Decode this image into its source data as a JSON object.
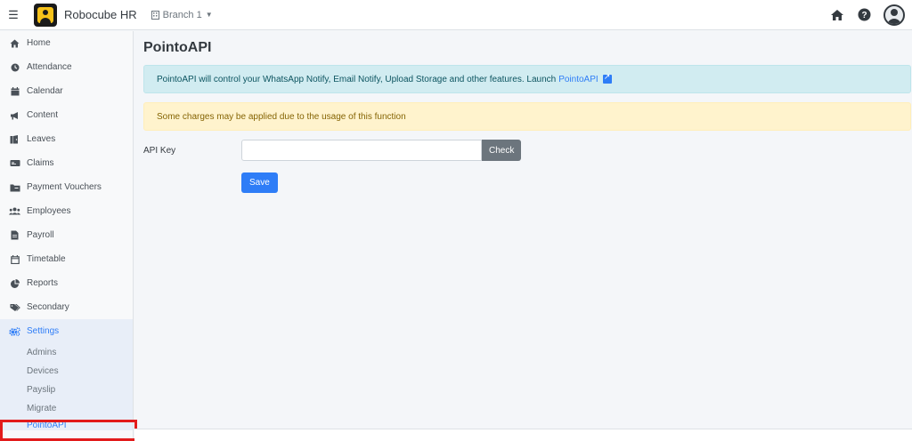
{
  "topbar": {
    "brand": "Robocube HR",
    "branch": "Branch 1"
  },
  "sidebar": {
    "items": [
      {
        "label": "Home",
        "icon": "home-icon"
      },
      {
        "label": "Attendance",
        "icon": "clock-icon"
      },
      {
        "label": "Calendar",
        "icon": "calendar-icon"
      },
      {
        "label": "Content",
        "icon": "megaphone-icon"
      },
      {
        "label": "Leaves",
        "icon": "leaves-icon"
      },
      {
        "label": "Claims",
        "icon": "money-icon"
      },
      {
        "label": "Payment Vouchers",
        "icon": "voucher-icon"
      },
      {
        "label": "Employees",
        "icon": "users-icon"
      },
      {
        "label": "Payroll",
        "icon": "document-icon"
      },
      {
        "label": "Timetable",
        "icon": "calendar-outline-icon"
      },
      {
        "label": "Reports",
        "icon": "pie-chart-icon"
      },
      {
        "label": "Secondary",
        "icon": "tags-icon"
      },
      {
        "label": "Settings",
        "icon": "cogs-icon"
      }
    ],
    "settings_sub": [
      "Admins",
      "Devices",
      "Payslip",
      "Migrate",
      "PointoAPI"
    ]
  },
  "main": {
    "title": "PointoAPI",
    "info_text": "PointoAPI will control your WhatsApp Notify, Email Notify, Upload Storage and other features. Launch",
    "info_link": "PointoAPI",
    "warning_text": "Some charges may be applied due to the usage of this function",
    "api_key_label": "API Key",
    "api_key_value": "",
    "check_label": "Check",
    "save_label": "Save"
  },
  "colors": {
    "accent": "#2e7df7",
    "info_bg": "#d1ecf1",
    "warning_bg": "#fff3cd",
    "highlight": "#e21b1b"
  }
}
